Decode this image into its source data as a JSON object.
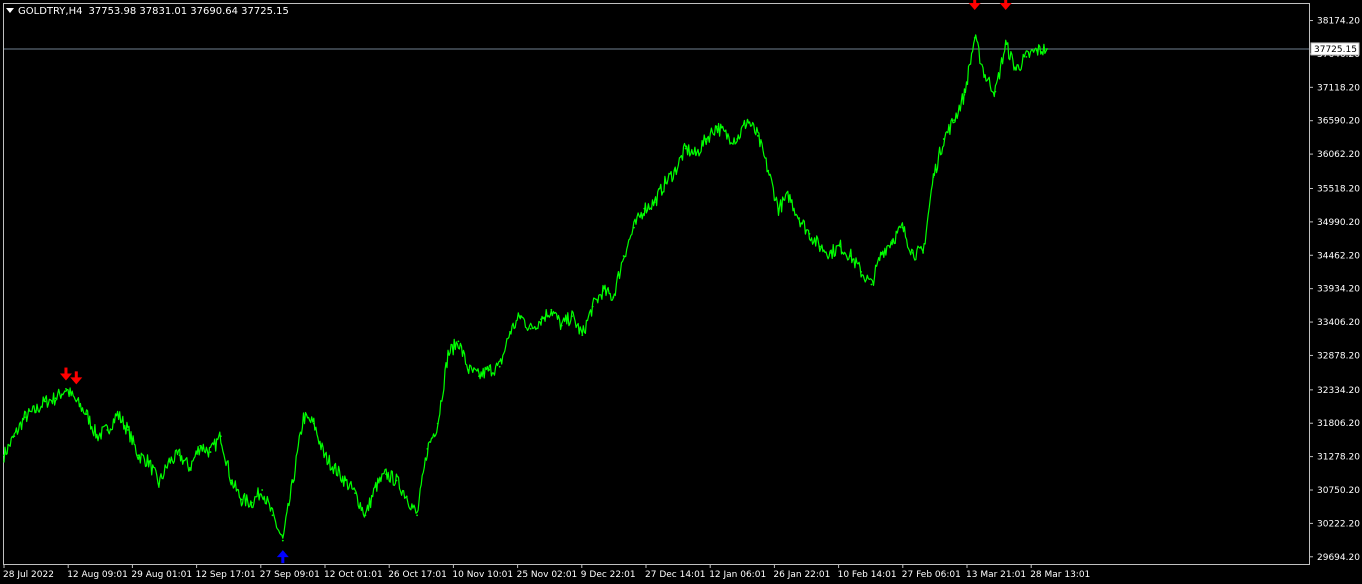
{
  "header": {
    "symbol": "GOLDTRY,H4",
    "ohlc": "37753.98 37831.01 37690.64 37725.15"
  },
  "colors": {
    "background": "#000000",
    "frame": "#c0c0c0",
    "price": "#00ff00",
    "sell_arrow": "#ff0000",
    "buy_arrow": "#0000ff",
    "bid_line": "#708090",
    "text": "#ffffff"
  },
  "chart_data": {
    "type": "line",
    "grid": false,
    "ylim": [
      29580,
      38420
    ],
    "y_ticks": [
      "38174.20",
      "37646.20",
      "37118.20",
      "36590.20",
      "36062.20",
      "35518.20",
      "34990.20",
      "34462.20",
      "33934.20",
      "33406.20",
      "32878.20",
      "32334.20",
      "31806.20",
      "31278.20",
      "30750.20",
      "30222.20",
      "29694.20"
    ],
    "x_ticks": [
      "28 Jul 2022",
      "12 Aug 09:01",
      "29 Aug 01:01",
      "12 Sep 17:01",
      "27 Sep 09:01",
      "12 Oct 01:01",
      "26 Oct 17:01",
      "10 Nov 10:01",
      "25 Nov 02:01",
      "9 Dec 22:01",
      "27 Dec 14:01",
      "12 Jan 06:01",
      "26 Jan 22:01",
      "10 Feb 14:01",
      "27 Feb 06:01",
      "13 Mar 21:01",
      "28 Mar 13:01"
    ],
    "current_price": 37725.15,
    "current_price_label": "37725.15",
    "series": [
      {
        "values": [
          31300,
          31600,
          31900,
          32000,
          32150,
          32200,
          32350,
          32150,
          31950,
          31600,
          31700,
          31950,
          31700,
          31300,
          31200,
          30850,
          31200,
          31300,
          31100,
          31450,
          31350,
          31600,
          30900,
          30600,
          30550,
          30750,
          30350,
          29950,
          30900,
          31900,
          31800,
          31300,
          31100,
          30900,
          30700,
          30350,
          30800,
          31000,
          30900,
          30650,
          30350,
          31400,
          31800,
          32900,
          33100,
          32650,
          32550,
          32650,
          32700,
          33250,
          33500,
          33300,
          33450,
          33600,
          33350,
          33500,
          33200,
          33650,
          33900,
          33800,
          34450,
          34900,
          35200,
          35300,
          35600,
          35800,
          36150,
          36050,
          36300,
          36500,
          36350,
          36300,
          36600,
          36350,
          35800,
          35200,
          35400,
          35050,
          34800,
          34600,
          34500,
          34600,
          34450,
          34200,
          34000,
          34500,
          34700,
          34900,
          34500,
          34500,
          35700,
          36300,
          36600,
          37000,
          37900,
          37300,
          37050,
          37800,
          37400,
          37600,
          37700,
          37725
        ]
      }
    ],
    "arrows": [
      {
        "type": "sell",
        "index": 6,
        "value": 32560
      },
      {
        "type": "sell",
        "index": 7,
        "value": 32500
      },
      {
        "type": "buy",
        "index": 27,
        "value": 29720
      },
      {
        "type": "sell",
        "index": 94,
        "value": 38420
      },
      {
        "type": "sell",
        "index": 97,
        "value": 38420
      }
    ]
  }
}
